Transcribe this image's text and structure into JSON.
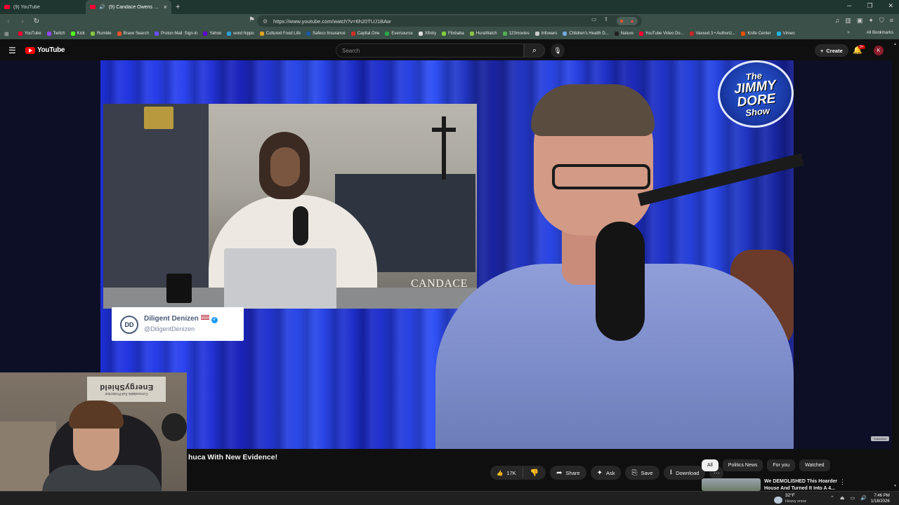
{
  "browser": {
    "tabs": [
      {
        "label": "(9) YouTube",
        "active": false
      },
      {
        "label": "(9) Candace Owens VINDICAT",
        "active": true
      }
    ],
    "url": "https://www.youtube.com/watch?v=6h20TUJ1BAw",
    "bookmarks": [
      {
        "label": "YouTube",
        "color": "#ff0033"
      },
      {
        "label": "Twitch",
        "color": "#9146ff"
      },
      {
        "label": "Kick",
        "color": "#53fc18"
      },
      {
        "label": "Rumble",
        "color": "#85c742"
      },
      {
        "label": "Brave Search",
        "color": "#fb542b"
      },
      {
        "label": "Proton Mail: Sign-in",
        "color": "#6d4aff"
      },
      {
        "label": "Yahoo",
        "color": "#6001d2"
      },
      {
        "label": "word hippo",
        "color": "#2aa0d8"
      },
      {
        "label": "Cultured Food Life",
        "color": "#e0a020"
      },
      {
        "label": "Safeco Insurance",
        "color": "#1a5aa8"
      },
      {
        "label": "Capital One",
        "color": "#d03027"
      },
      {
        "label": "Eversource",
        "color": "#2aa84a"
      },
      {
        "label": "Xfinity",
        "color": "#dddddd"
      },
      {
        "label": "Flixbaba",
        "color": "#7fd13b"
      },
      {
        "label": "HuraWatch",
        "color": "#8bc34a"
      },
      {
        "label": "123movies",
        "color": "#4caf50"
      },
      {
        "label": "Infowars",
        "color": "#cccccc"
      },
      {
        "label": "Children's Health D...",
        "color": "#6fa8dc"
      },
      {
        "label": "Nature",
        "color": "#222222"
      },
      {
        "label": "YouTube Video Do...",
        "color": "#ff0033"
      },
      {
        "label": "Vaxxed 3 • Authoriz...",
        "color": "#c62828"
      },
      {
        "label": "Knife Center",
        "color": "#e65100"
      },
      {
        "label": "Vimeo",
        "color": "#1ab7ea"
      }
    ],
    "all_bookmarks_label": "All Bookmarks",
    "more_label": "»"
  },
  "youtube": {
    "logo_text": "YouTube",
    "search_placeholder": "Search",
    "create_label": "Create",
    "notif_count": "9+",
    "avatar_initial": "K"
  },
  "video": {
    "inset_brand": "CANDACE",
    "lower_third_name": "Diligent Denizen",
    "lower_third_handle": "@DiligentDenizen",
    "lower_third_monogram": "DD",
    "show_logo": [
      "The",
      "JIMMY",
      "DORE",
      "Show"
    ],
    "watermark": "Subscribe",
    "webcam_banner_big": "EnergyShield",
    "webcam_banner_small": "Concealable Full Protection",
    "title_visible": "huca With New Evidence!"
  },
  "actions": {
    "like_count": "17K",
    "share_label": "Share",
    "ask_label": "Ask",
    "save_label": "Save",
    "download_label": "Download"
  },
  "chips": [
    "All",
    "Politics News",
    "For you",
    "Watched"
  ],
  "recommendation": {
    "title": "We DEMOLISHED This Hoarder House And Turned It Into A 4..."
  },
  "taskbar": {
    "temperature": "32°F",
    "condition": "Heavy snow",
    "time": "7:46 PM",
    "date": "1/18/2026"
  }
}
